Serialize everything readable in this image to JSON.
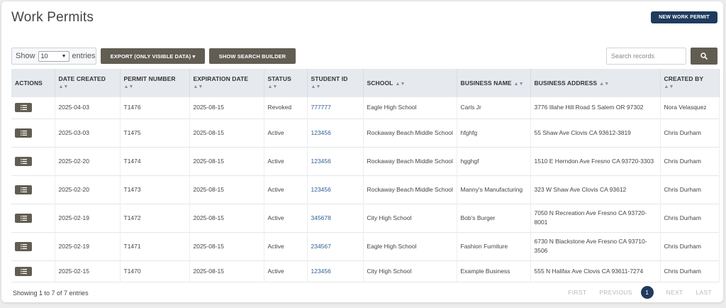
{
  "page": {
    "title": "Work Permits",
    "new_button": "NEW WORK PERMIT"
  },
  "toolbar": {
    "show_label": "Show",
    "show_value": "10",
    "entries_label": "entries",
    "export_label": "EXPORT (ONLY VISIBLE DATA) ▾",
    "builder_label": "SHOW SEARCH BUILDER",
    "search_placeholder": "Search records"
  },
  "table": {
    "headers": [
      "ACTIONS",
      "DATE CREATED",
      "PERMIT NUMBER",
      "EXPIRATION DATE",
      "STATUS",
      "STUDENT ID",
      "SCHOOL",
      "BUSINESS NAME",
      "BUSINESS ADDRESS",
      "CREATED BY"
    ],
    "rows": [
      {
        "date": "2025-04-03",
        "permit": "T1476",
        "expiration": "2025-08-15",
        "status": "Revoked",
        "student_id": "777777",
        "school": "Eagle High School",
        "business": "Carls Jr",
        "address": "3776 Illahe Hill Road S Salem OR 97302",
        "created_by": "Nora Velasquez"
      },
      {
        "date": "2025-03-03",
        "permit": "T1475",
        "expiration": "2025-08-15",
        "status": "Active",
        "student_id": "123456",
        "school": "Rockaway Beach Middle School",
        "business": "hfghfg",
        "address": "55 Shaw Ave Clovis CA 93612-3819",
        "created_by": "Chris Durham"
      },
      {
        "date": "2025-02-20",
        "permit": "T1474",
        "expiration": "2025-08-15",
        "status": "Active",
        "student_id": "123456",
        "school": "Rockaway Beach Middle School",
        "business": "hgghgf",
        "address": "1510 E Herndon Ave Fresno CA 93720-3303",
        "created_by": "Chris Durham"
      },
      {
        "date": "2025-02-20",
        "permit": "T1473",
        "expiration": "2025-08-15",
        "status": "Active",
        "student_id": "123456",
        "school": "Rockaway Beach Middle School",
        "business": "Manny's Manufacturing",
        "address": "323 W Shaw Ave Clovis CA 93612",
        "created_by": "Chris Durham"
      },
      {
        "date": "2025-02-19",
        "permit": "T1472",
        "expiration": "2025-08-15",
        "status": "Active",
        "student_id": "345678",
        "school": "City High School",
        "business": "Bob's Burger",
        "address": "7050 N Recreation Ave Fresno CA 93720-8001",
        "created_by": "Chris Durham"
      },
      {
        "date": "2025-02-19",
        "permit": "T1471",
        "expiration": "2025-08-15",
        "status": "Active",
        "student_id": "234567",
        "school": "Eagle High School",
        "business": "Fashion Furniture",
        "address": "6730 N Blackstone Ave Fresno CA 93710-3506",
        "created_by": "Chris Durham"
      },
      {
        "date": "2025-02-15",
        "permit": "T1470",
        "expiration": "2025-08-15",
        "status": "Active",
        "student_id": "123456",
        "school": "City High School",
        "business": "Example Business",
        "address": "555 N Halifax Ave Clovis CA 93611-7274",
        "created_by": "Chris Durham"
      }
    ]
  },
  "footer": {
    "info": "Showing 1 to 7 of 7 entries",
    "first": "FIRST",
    "previous": "PREVIOUS",
    "current_page": "1",
    "next": "NEXT",
    "last": "LAST"
  },
  "icons": {
    "row_action": "list-icon",
    "search": "search-icon",
    "sort": "sort-icon"
  },
  "colors": {
    "primary": "#1f3b5e",
    "button_dark": "#625d52",
    "link": "#2e5d95",
    "header_bg": "#e6eaef"
  }
}
